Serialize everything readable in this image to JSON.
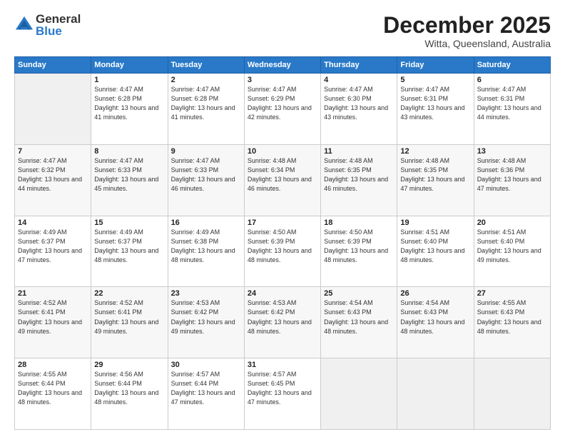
{
  "logo": {
    "general": "General",
    "blue": "Blue"
  },
  "header": {
    "month": "December 2025",
    "location": "Witta, Queensland, Australia"
  },
  "weekdays": [
    "Sunday",
    "Monday",
    "Tuesday",
    "Wednesday",
    "Thursday",
    "Friday",
    "Saturday"
  ],
  "weeks": [
    [
      {
        "day": "",
        "sunrise": "",
        "sunset": "",
        "daylight": ""
      },
      {
        "day": "1",
        "sunrise": "Sunrise: 4:47 AM",
        "sunset": "Sunset: 6:28 PM",
        "daylight": "Daylight: 13 hours and 41 minutes."
      },
      {
        "day": "2",
        "sunrise": "Sunrise: 4:47 AM",
        "sunset": "Sunset: 6:28 PM",
        "daylight": "Daylight: 13 hours and 41 minutes."
      },
      {
        "day": "3",
        "sunrise": "Sunrise: 4:47 AM",
        "sunset": "Sunset: 6:29 PM",
        "daylight": "Daylight: 13 hours and 42 minutes."
      },
      {
        "day": "4",
        "sunrise": "Sunrise: 4:47 AM",
        "sunset": "Sunset: 6:30 PM",
        "daylight": "Daylight: 13 hours and 43 minutes."
      },
      {
        "day": "5",
        "sunrise": "Sunrise: 4:47 AM",
        "sunset": "Sunset: 6:31 PM",
        "daylight": "Daylight: 13 hours and 43 minutes."
      },
      {
        "day": "6",
        "sunrise": "Sunrise: 4:47 AM",
        "sunset": "Sunset: 6:31 PM",
        "daylight": "Daylight: 13 hours and 44 minutes."
      }
    ],
    [
      {
        "day": "7",
        "sunrise": "Sunrise: 4:47 AM",
        "sunset": "Sunset: 6:32 PM",
        "daylight": "Daylight: 13 hours and 44 minutes."
      },
      {
        "day": "8",
        "sunrise": "Sunrise: 4:47 AM",
        "sunset": "Sunset: 6:33 PM",
        "daylight": "Daylight: 13 hours and 45 minutes."
      },
      {
        "day": "9",
        "sunrise": "Sunrise: 4:47 AM",
        "sunset": "Sunset: 6:33 PM",
        "daylight": "Daylight: 13 hours and 46 minutes."
      },
      {
        "day": "10",
        "sunrise": "Sunrise: 4:48 AM",
        "sunset": "Sunset: 6:34 PM",
        "daylight": "Daylight: 13 hours and 46 minutes."
      },
      {
        "day": "11",
        "sunrise": "Sunrise: 4:48 AM",
        "sunset": "Sunset: 6:35 PM",
        "daylight": "Daylight: 13 hours and 46 minutes."
      },
      {
        "day": "12",
        "sunrise": "Sunrise: 4:48 AM",
        "sunset": "Sunset: 6:35 PM",
        "daylight": "Daylight: 13 hours and 47 minutes."
      },
      {
        "day": "13",
        "sunrise": "Sunrise: 4:48 AM",
        "sunset": "Sunset: 6:36 PM",
        "daylight": "Daylight: 13 hours and 47 minutes."
      }
    ],
    [
      {
        "day": "14",
        "sunrise": "Sunrise: 4:49 AM",
        "sunset": "Sunset: 6:37 PM",
        "daylight": "Daylight: 13 hours and 47 minutes."
      },
      {
        "day": "15",
        "sunrise": "Sunrise: 4:49 AM",
        "sunset": "Sunset: 6:37 PM",
        "daylight": "Daylight: 13 hours and 48 minutes."
      },
      {
        "day": "16",
        "sunrise": "Sunrise: 4:49 AM",
        "sunset": "Sunset: 6:38 PM",
        "daylight": "Daylight: 13 hours and 48 minutes."
      },
      {
        "day": "17",
        "sunrise": "Sunrise: 4:50 AM",
        "sunset": "Sunset: 6:39 PM",
        "daylight": "Daylight: 13 hours and 48 minutes."
      },
      {
        "day": "18",
        "sunrise": "Sunrise: 4:50 AM",
        "sunset": "Sunset: 6:39 PM",
        "daylight": "Daylight: 13 hours and 48 minutes."
      },
      {
        "day": "19",
        "sunrise": "Sunrise: 4:51 AM",
        "sunset": "Sunset: 6:40 PM",
        "daylight": "Daylight: 13 hours and 48 minutes."
      },
      {
        "day": "20",
        "sunrise": "Sunrise: 4:51 AM",
        "sunset": "Sunset: 6:40 PM",
        "daylight": "Daylight: 13 hours and 49 minutes."
      }
    ],
    [
      {
        "day": "21",
        "sunrise": "Sunrise: 4:52 AM",
        "sunset": "Sunset: 6:41 PM",
        "daylight": "Daylight: 13 hours and 49 minutes."
      },
      {
        "day": "22",
        "sunrise": "Sunrise: 4:52 AM",
        "sunset": "Sunset: 6:41 PM",
        "daylight": "Daylight: 13 hours and 49 minutes."
      },
      {
        "day": "23",
        "sunrise": "Sunrise: 4:53 AM",
        "sunset": "Sunset: 6:42 PM",
        "daylight": "Daylight: 13 hours and 49 minutes."
      },
      {
        "day": "24",
        "sunrise": "Sunrise: 4:53 AM",
        "sunset": "Sunset: 6:42 PM",
        "daylight": "Daylight: 13 hours and 48 minutes."
      },
      {
        "day": "25",
        "sunrise": "Sunrise: 4:54 AM",
        "sunset": "Sunset: 6:43 PM",
        "daylight": "Daylight: 13 hours and 48 minutes."
      },
      {
        "day": "26",
        "sunrise": "Sunrise: 4:54 AM",
        "sunset": "Sunset: 6:43 PM",
        "daylight": "Daylight: 13 hours and 48 minutes."
      },
      {
        "day": "27",
        "sunrise": "Sunrise: 4:55 AM",
        "sunset": "Sunset: 6:43 PM",
        "daylight": "Daylight: 13 hours and 48 minutes."
      }
    ],
    [
      {
        "day": "28",
        "sunrise": "Sunrise: 4:55 AM",
        "sunset": "Sunset: 6:44 PM",
        "daylight": "Daylight: 13 hours and 48 minutes."
      },
      {
        "day": "29",
        "sunrise": "Sunrise: 4:56 AM",
        "sunset": "Sunset: 6:44 PM",
        "daylight": "Daylight: 13 hours and 48 minutes."
      },
      {
        "day": "30",
        "sunrise": "Sunrise: 4:57 AM",
        "sunset": "Sunset: 6:44 PM",
        "daylight": "Daylight: 13 hours and 47 minutes."
      },
      {
        "day": "31",
        "sunrise": "Sunrise: 4:57 AM",
        "sunset": "Sunset: 6:45 PM",
        "daylight": "Daylight: 13 hours and 47 minutes."
      },
      {
        "day": "",
        "sunrise": "",
        "sunset": "",
        "daylight": ""
      },
      {
        "day": "",
        "sunrise": "",
        "sunset": "",
        "daylight": ""
      },
      {
        "day": "",
        "sunrise": "",
        "sunset": "",
        "daylight": ""
      }
    ]
  ]
}
